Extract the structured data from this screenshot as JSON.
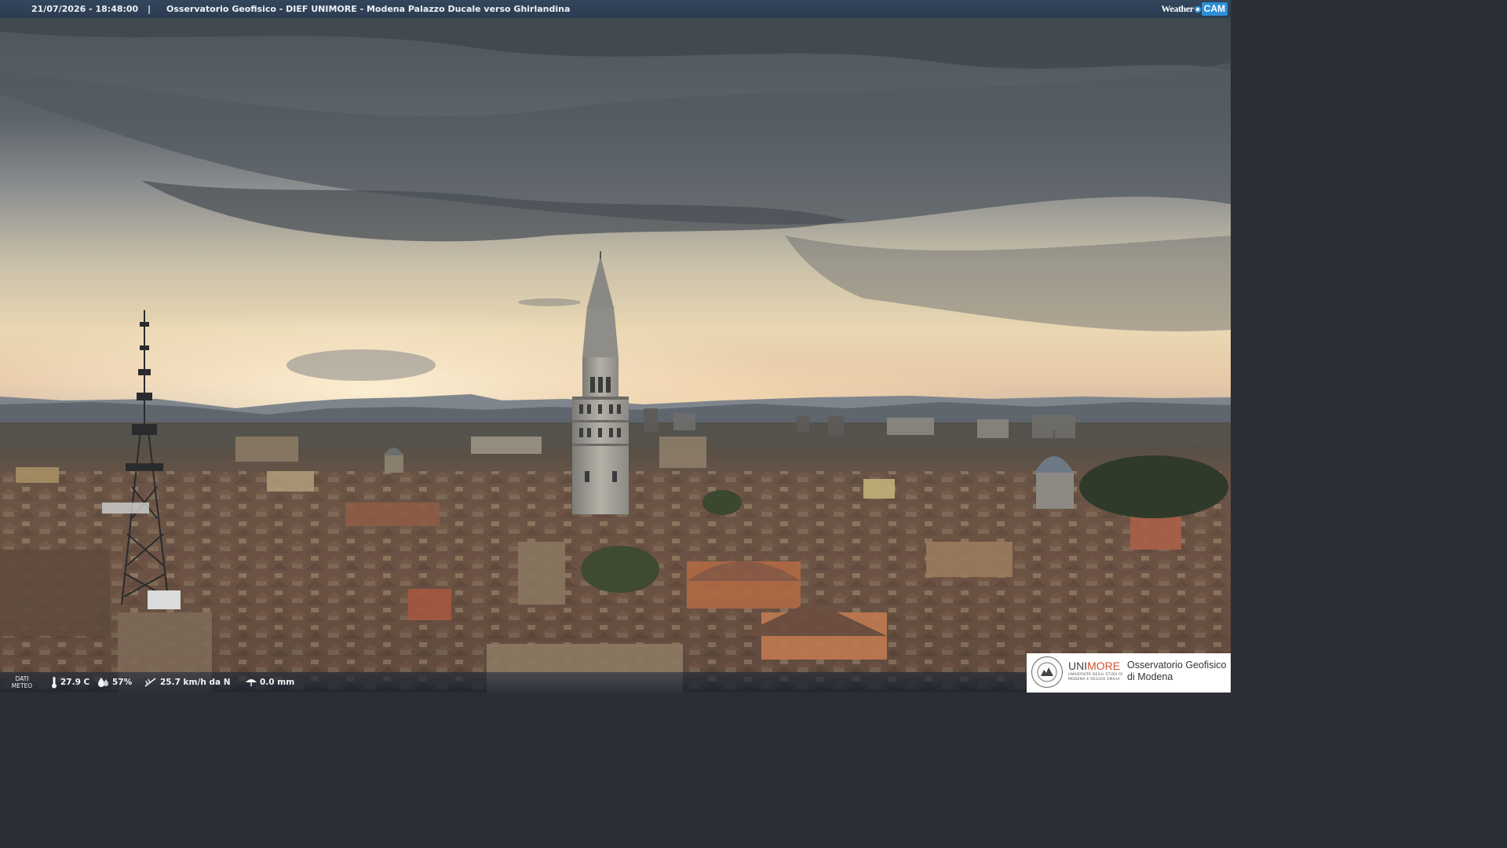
{
  "header": {
    "timestamp": "21/07/2026 - 18:48:00",
    "separator": "|",
    "title": "Osservatorio Geofisico - DIEF UNIMORE - Modena Palazzo Ducale verso Ghirlandina",
    "brand": {
      "weather": "Weather",
      "cam": "CAM"
    }
  },
  "weather_bar": {
    "label": "DATI METEO",
    "temperature": "27.9 C",
    "humidity": "57%",
    "wind": "25.7 km/h da N",
    "rain": "0.0 mm"
  },
  "logo": {
    "brand_uni": "UNI",
    "brand_more": "MORE",
    "university_line": "UNIVERSITÀ DEGLI STUDI DI MODENA E REGGIO EMILIA",
    "observatory_line1": "Osservatorio Geofisico",
    "observatory_line2": "di Modena"
  },
  "colors": {
    "sky_top": "#4e555d",
    "sky_glow": "#f1dcb2",
    "roofs": "#6b5446",
    "header_bar": "#2f4257",
    "unimore_accent": "#d0502a"
  }
}
